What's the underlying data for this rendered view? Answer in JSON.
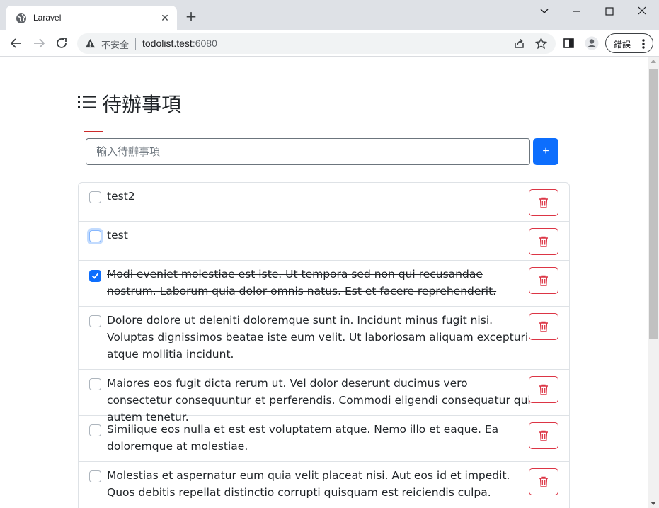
{
  "browser": {
    "tab_title": "Laravel",
    "insecure_label": "不安全",
    "url_host": "todolist.test",
    "url_port": ":6080",
    "error_chip_label": "錯誤",
    "icons": {
      "favicon": "globe-icon",
      "tab_close": "close-icon",
      "new_tab": "plus-icon",
      "back": "arrow-left-icon",
      "forward": "arrow-right-icon",
      "reload": "reload-icon",
      "warning": "warning-icon",
      "share": "share-icon",
      "bookmark": "star-icon",
      "side_panel": "side-panel-icon",
      "profile": "profile-icon",
      "menu": "kebab-menu-icon"
    }
  },
  "page": {
    "heading": "待辦事項",
    "input_placeholder": "輸入待辦事項",
    "add_button_label": "+",
    "colors": {
      "primary": "#0d6efd",
      "danger": "#dc3545",
      "border": "#dee2e6",
      "annotation": "#cc2a2a"
    },
    "todos": [
      {
        "text": "test2",
        "checked": false,
        "focused": false
      },
      {
        "text": "test",
        "checked": false,
        "focused": true
      },
      {
        "text": "Modi eveniet molestiae est iste. Ut tempora sed non qui recusandae nostrum. Laborum quia dolor omnis natus. Est et facere reprehenderit.",
        "checked": true,
        "focused": false
      },
      {
        "text": "Dolore dolore ut deleniti doloremque sunt in. Incidunt minus fugit nisi. Voluptas dignissimos beatae iste eum velit. Ut laboriosam aliquam excepturi atque mollitia incidunt.",
        "checked": false,
        "focused": false
      },
      {
        "text": "Maiores eos fugit dicta rerum ut. Vel dolor deserunt ducimus vero consectetur consequuntur et perferendis. Commodi eligendi consequatur qui autem tenetur.",
        "checked": false,
        "focused": false
      },
      {
        "text": "Similique eos nulla et est est voluptatem atque. Nemo illo et eaque. Ea doloremque at molestiae.",
        "checked": false,
        "focused": false
      },
      {
        "text": "Molestias et aspernatur eum quia velit placeat nisi. Aut eos id et impedit. Quos debitis repellat distinctio corrupti quisquam est reiciendis culpa.",
        "checked": false,
        "focused": false
      }
    ]
  }
}
